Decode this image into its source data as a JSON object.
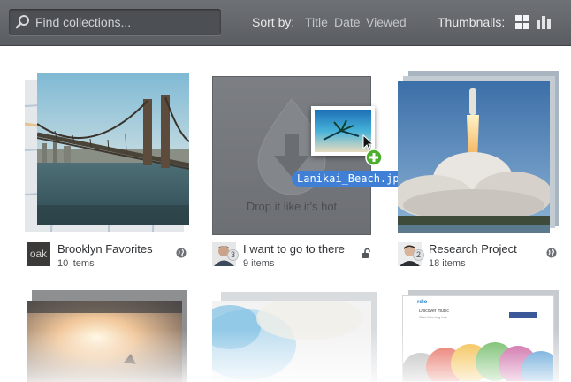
{
  "toolbar": {
    "search_placeholder": "Find collections...",
    "search_icon": "magnifier-icon",
    "sort_label": "Sort by:",
    "sort_options": [
      "Title",
      "Date",
      "Viewed"
    ],
    "thumbnails_label": "Thumbnails:",
    "view_icons": [
      "grid-view-icon",
      "bar-view-icon"
    ]
  },
  "drop_zone": {
    "text": "Drop it like it’s hot",
    "dragged_file": "Lanikai_Beach.jpg"
  },
  "collections": [
    {
      "title": "Brooklyn Favorites",
      "count": "10 items",
      "avatar_text": "oak",
      "badge": "",
      "status_icon": "globe-icon"
    },
    {
      "title": "I want to go to there",
      "count": "9 items",
      "avatar_text": "",
      "badge": "3",
      "status_icon": "lock-icon"
    },
    {
      "title": "Research Project",
      "count": "18 items",
      "avatar_text": "",
      "badge": "2",
      "status_icon": "globe-icon"
    }
  ],
  "rdio_snippet": {
    "brand": "rdio",
    "tagline_1": "Discover music",
    "tagline_2": "Start listening free"
  },
  "colors": {
    "toolbar": "#626569",
    "drag_label": "#3f80d6",
    "add_badge": "#4caf2c"
  }
}
